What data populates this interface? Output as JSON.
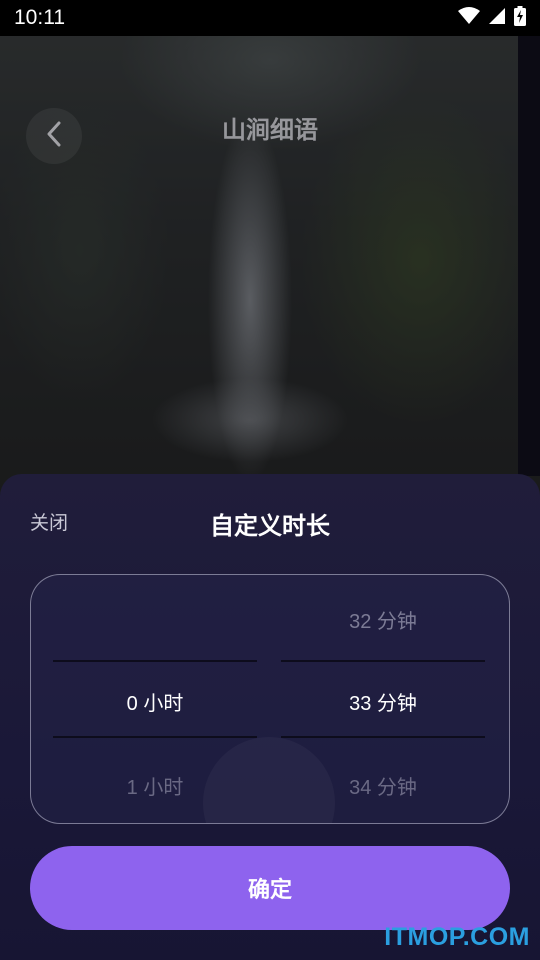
{
  "status_bar": {
    "time": "10:11",
    "icons": [
      "wifi-icon",
      "signal-icon",
      "battery-charging-icon"
    ]
  },
  "header": {
    "title": "山涧细语",
    "back_icon": "chevron-left-icon"
  },
  "sheet": {
    "close_label": "关闭",
    "title": "自定义时长",
    "picker": {
      "hours": {
        "above": "",
        "selected": "0 小时",
        "below": "1 小时"
      },
      "minutes": {
        "above": "32 分钟",
        "selected": "33 分钟",
        "below": "34 分钟"
      }
    },
    "confirm_label": "确定"
  },
  "watermark": "ITMOP.COM",
  "colors": {
    "accent": "#8e63ee",
    "sheet_bg": "#1c1a38",
    "watermark": "#2b9fe0"
  }
}
